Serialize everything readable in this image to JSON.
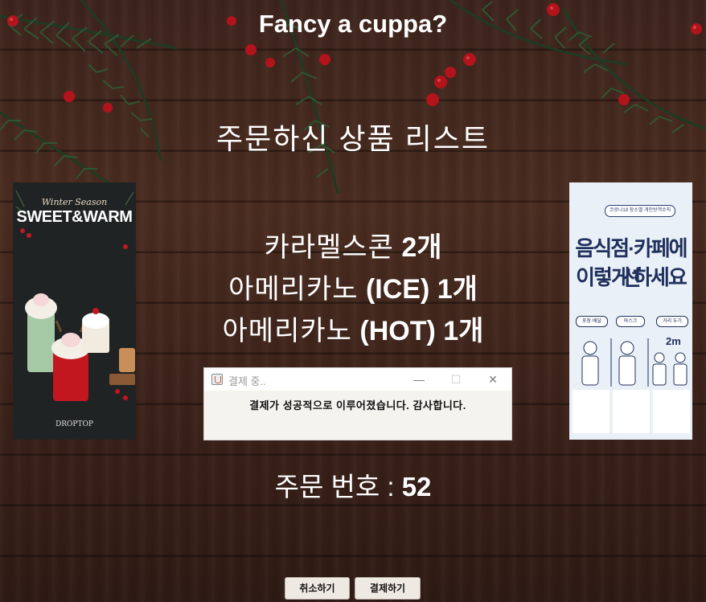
{
  "header": {
    "title": "Fancy a cuppa?",
    "subtitle": "주문하신 상품 리스트"
  },
  "order": {
    "items": [
      {
        "name": "카라멜스콘",
        "qty": "2개"
      },
      {
        "name": "아메리카노",
        "qty": "(ICE) 1개"
      },
      {
        "name": "아메리카노",
        "qty": "(HOT) 1개"
      }
    ],
    "number_label": "주문 번호 :",
    "number_value": "52"
  },
  "dialog": {
    "title": "결제 중..",
    "message": "결제가 성공적으로 이루어졌습니다. 감사합니다.",
    "minimize_glyph": "—",
    "maximize_glyph": "☐",
    "close_glyph": "✕"
  },
  "buttons": {
    "cancel": "취소하기",
    "pay": "결제하기"
  },
  "poster_left": {
    "season": "Winter Season",
    "title": "SWEET&WARM",
    "brand": "DROPTOP"
  },
  "poster_right": {
    "banner": "코로나19 장소별 개인방역수칙",
    "headline_1": "음식점·카페에선",
    "headline_2": "이렇게 하세요",
    "tags": [
      "포장·배달",
      "마스크",
      "거리 두기"
    ],
    "distance": "2m"
  },
  "colors": {
    "wood": "#3d241c",
    "text": "#ffffff",
    "button_bg": "#eee9e2",
    "dialog_bg": "#f5f3ee"
  }
}
